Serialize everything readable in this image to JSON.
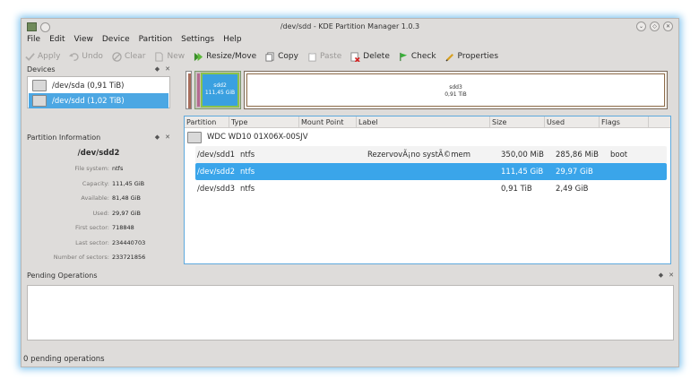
{
  "window": {
    "title": "/dev/sdd - KDE Partition Manager 1.0.3",
    "controls": [
      "chevron-down-icon",
      "restore-icon",
      "close-icon"
    ]
  },
  "menu": [
    "File",
    "Edit",
    "View",
    "Device",
    "Partition",
    "Settings",
    "Help"
  ],
  "toolbar": {
    "apply": "Apply",
    "undo": "Undo",
    "clear": "Clear",
    "new": "New",
    "resize_move": "Resize/Move",
    "copy": "Copy",
    "paste": "Paste",
    "delete": "Delete",
    "check": "Check",
    "properties": "Properties"
  },
  "devices": {
    "title": "Devices",
    "items": [
      {
        "label": "/dev/sda (0,91 TiB)",
        "selected": false
      },
      {
        "label": "/dev/sdd (1,02 TiB)",
        "selected": true
      }
    ]
  },
  "partition_graph": {
    "sdd2": {
      "name": "sdd2",
      "size": "111,45 GiB"
    },
    "sdd3": {
      "name": "sdd3",
      "size": "0,91 TiB"
    }
  },
  "partition_info": {
    "title": "Partition Information",
    "name": "/dev/sdd2",
    "rows": [
      {
        "k": "File system:",
        "v": "ntfs"
      },
      {
        "k": "Capacity:",
        "v": "111,45 GiB"
      },
      {
        "k": "Available:",
        "v": "81,48 GiB"
      },
      {
        "k": "Used:",
        "v": "29,97 GiB"
      },
      {
        "k": "First sector:",
        "v": "718848"
      },
      {
        "k": "Last sector:",
        "v": "234440703"
      },
      {
        "k": "Number of sectors:",
        "v": "233721856"
      }
    ]
  },
  "table": {
    "headers": [
      "Partition",
      "Type",
      "Mount Point",
      "Label",
      "Size",
      "Used",
      "Flags"
    ],
    "disk_name": "WDC WD10 01X06X-00SJV",
    "rows": [
      {
        "partition": "/dev/sdd1",
        "type": "ntfs",
        "mount": "",
        "label": "RezervovÃ¡no systÃ©mem",
        "size": "350,00 MiB",
        "used": "285,86 MiB",
        "flags": "boot"
      },
      {
        "partition": "/dev/sdd2",
        "type": "ntfs",
        "mount": "",
        "label": "",
        "size": "111,45 GiB",
        "used": "29,97 GiB",
        "flags": ""
      },
      {
        "partition": "/dev/sdd3",
        "type": "ntfs",
        "mount": "",
        "label": "",
        "size": "0,91 TiB",
        "used": "2,49 GiB",
        "flags": ""
      }
    ]
  },
  "pending": {
    "title": "Pending Operations"
  },
  "status": "0 pending operations",
  "colors": {
    "accent": "#3aa5ea",
    "window_bg": "#dedcda",
    "glow": "#7fc3ee"
  }
}
